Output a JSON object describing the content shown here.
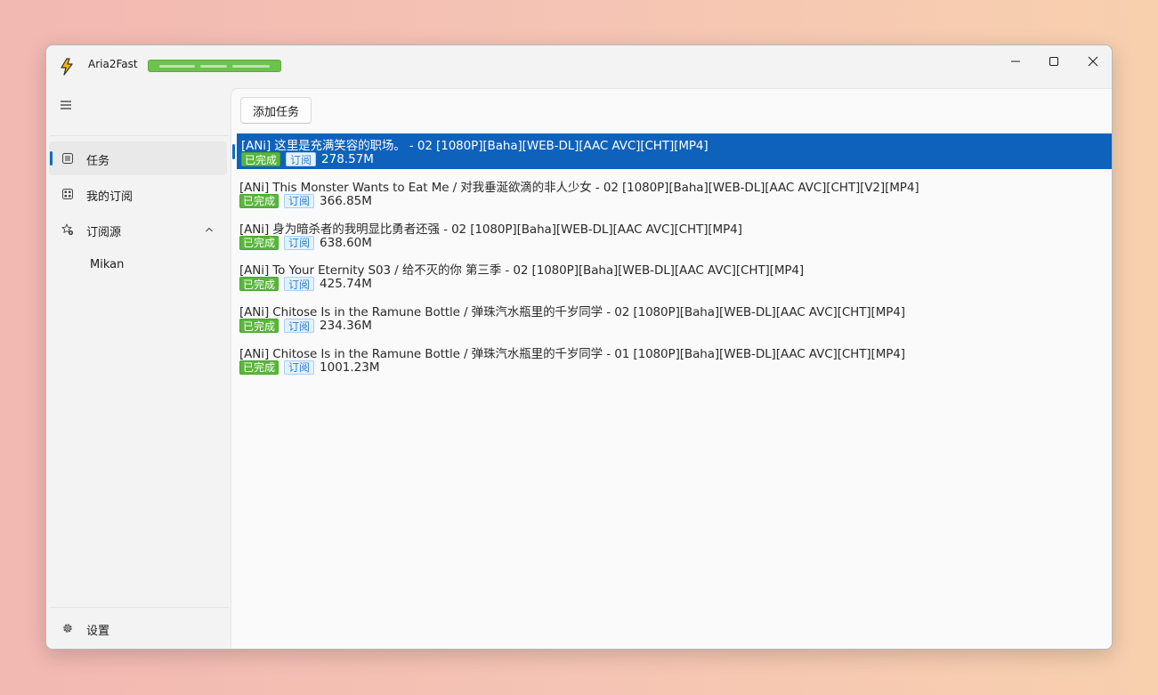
{
  "window": {
    "title": "Aria2Fast"
  },
  "sidebar": {
    "items": [
      {
        "label": "任务",
        "icon": "task-list-icon",
        "selected": true
      },
      {
        "label": "我的订阅",
        "icon": "subscription-grid-icon"
      },
      {
        "label": "订阅源",
        "icon": "star-gear-icon",
        "expanded": true
      }
    ],
    "subitems": [
      {
        "label": "Mikan"
      }
    ],
    "settings_label": "设置"
  },
  "toolbar": {
    "add_task_label": "添加任务"
  },
  "tasks": [
    {
      "title": "[ANi]  这里是充满笑容的职场。 - 02 [1080P][Baha][WEB-DL][AAC AVC][CHT][MP4]",
      "status": "已完成",
      "tag": "订阅",
      "size": "278.57M",
      "selected": true
    },
    {
      "title": "[ANi] This Monster Wants to Eat Me /  对我垂涎欲滴的非人少女 - 02 [1080P][Baha][WEB-DL][AAC AVC][CHT][V2][MP4]",
      "status": "已完成",
      "tag": "订阅",
      "size": "366.85M"
    },
    {
      "title": "[ANi]  身为暗杀者的我明显比勇者还强 - 02 [1080P][Baha][WEB-DL][AAC AVC][CHT][MP4]",
      "status": "已完成",
      "tag": "订阅",
      "size": "638.60M"
    },
    {
      "title": "[ANi] To Your Eternity S03 /  给不灭的你 第三季 - 02 [1080P][Baha][WEB-DL][AAC AVC][CHT][MP4]",
      "status": "已完成",
      "tag": "订阅",
      "size": "425.74M"
    },
    {
      "title": "[ANi] Chitose Is in the Ramune Bottle /  弹珠汽水瓶里的千岁同学 - 02 [1080P][Baha][WEB-DL][AAC AVC][CHT][MP4]",
      "status": "已完成",
      "tag": "订阅",
      "size": "234.36M"
    },
    {
      "title": "[ANi] Chitose Is in the Ramune Bottle /  弹珠汽水瓶里的千岁同学 - 01 [1080P][Baha][WEB-DL][AAC AVC][CHT][MP4]",
      "status": "已完成",
      "tag": "订阅",
      "size": "1001.23M"
    }
  ],
  "colors": {
    "accent": "#0f62bc",
    "done_badge": "#59b63c",
    "sub_badge_text": "#2f7fd0"
  }
}
